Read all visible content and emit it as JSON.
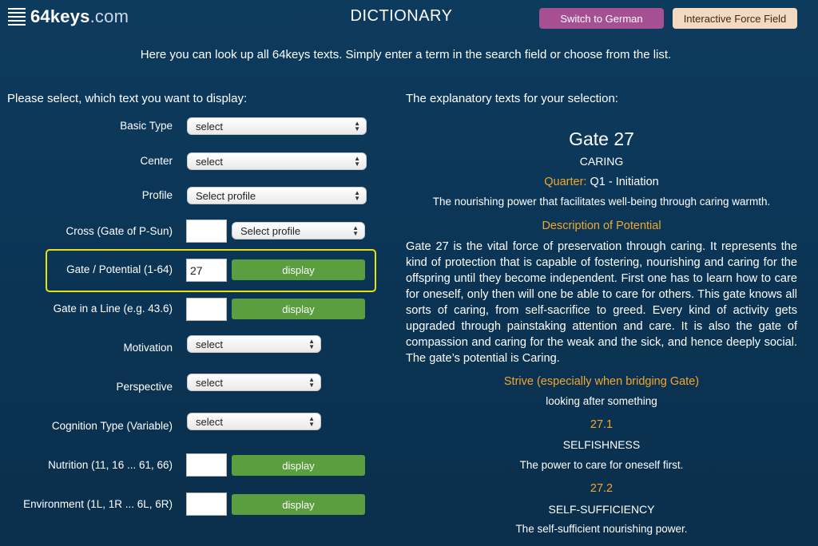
{
  "header": {
    "logo_bold": "64",
    "logo_mid": "keys",
    "logo_domain": ".com",
    "title": "DICTIONARY",
    "switch_button": "Switch to German",
    "force_button": "Interactive Force Field"
  },
  "intro": "Here you can look up all 64keys texts. Simply enter a term in the search field or choose from the list.",
  "left": {
    "heading": "Please select, which text you want to display:",
    "basic_type": {
      "label": "Basic Type",
      "value": "select"
    },
    "center": {
      "label": "Center",
      "value": "select"
    },
    "profile": {
      "label": "Profile",
      "value": "Select profile"
    },
    "cross": {
      "label": "Cross (Gate of P-Sun)",
      "input": "",
      "value": "Select profile"
    },
    "gate": {
      "label": "Gate / Potential (1-64)",
      "input": "27",
      "button": "display"
    },
    "gate_line": {
      "label": "Gate in a Line (e.g. 43.6)",
      "input": "",
      "button": "display"
    },
    "motivation": {
      "label": "Motivation",
      "value": "select"
    },
    "perspective": {
      "label": "Perspective",
      "value": "select"
    },
    "cognition": {
      "label": "Cognition Type (Variable)",
      "value": "select"
    },
    "nutrition": {
      "label": "Nutrition (11, 16 ... 61, 66)",
      "input": "",
      "button": "display"
    },
    "environment": {
      "label": "Environment (1L, 1R ... 6L, 6R)",
      "input": "",
      "button": "display"
    }
  },
  "right": {
    "heading": "The explanatory texts for your selection:",
    "gate_title": "Gate 27",
    "gate_name": "CARING",
    "quarter_label": "Quarter:",
    "quarter_value": " Q1 - Initiation",
    "summary": "The nourishing power that facilitates well-being through caring warmth.",
    "desc_heading": "Description of Potential",
    "description": "Gate 27 is the vital force of preservation through caring. It represents the kind of protection that is capable of fostering, nourishing and caring for the offspring until they become independent. First one has to learn how to care for oneself, only then will one be able to care for others. This gate knows all sorts of caring, from self-sacrifice to greed. Every kind of activity gets upgraded through painstaking attention and care. It is also the gate of compassion and caring for the weak and the sick, and hence deeply social. The gate’s potential is Caring.",
    "strive_heading": "Strive (especially when bridging Gate)",
    "strive_text": "looking after something",
    "line1_num": "27.1",
    "line1_name": "SELFISHNESS",
    "line1_text": "The power to care for oneself first.",
    "line2_num": "27.2",
    "line2_name": "SELF-SUFFICIENCY",
    "line2_text": "The self-sufficient nourishing power."
  }
}
